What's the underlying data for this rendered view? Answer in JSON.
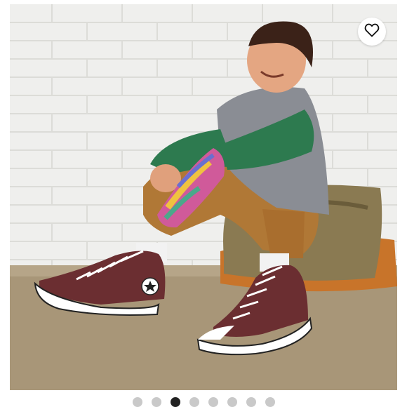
{
  "gallery": {
    "favorite_button": {
      "icon": "heart-outline-icon"
    },
    "pagination": {
      "total": 8,
      "active_index": 2
    }
  }
}
